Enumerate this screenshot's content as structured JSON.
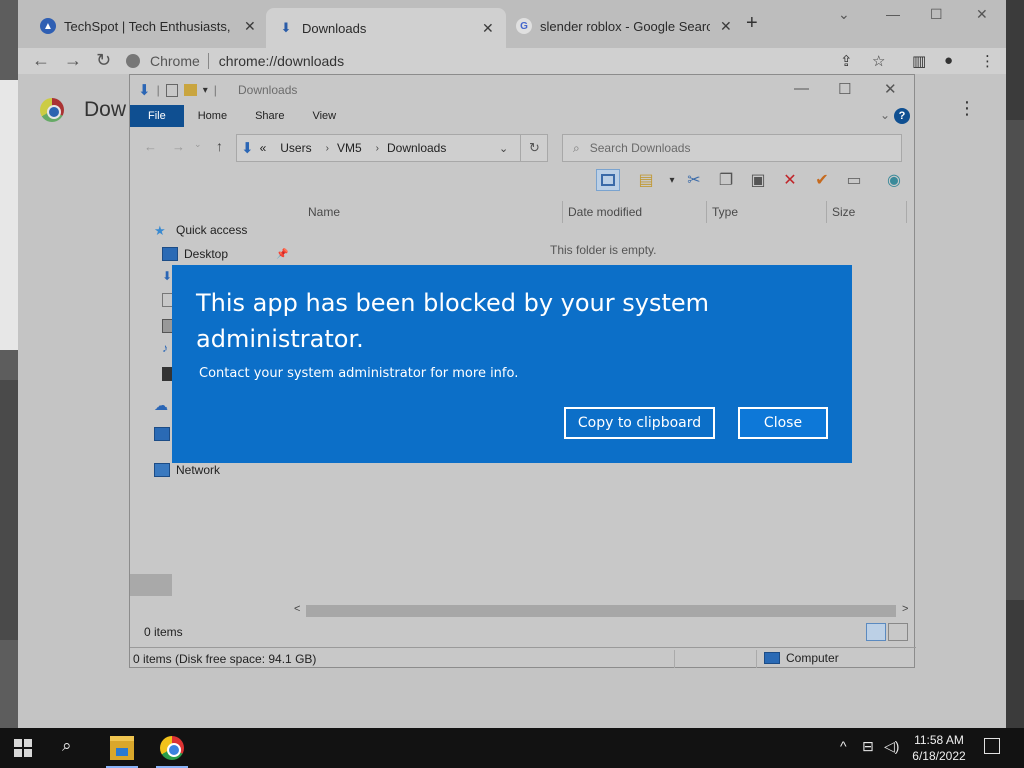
{
  "browser": {
    "tabs": [
      {
        "title": "TechSpot | Tech Enthusiasts, Pow",
        "active": false
      },
      {
        "title": "Downloads",
        "active": true
      },
      {
        "title": "slender roblox - Google Search",
        "active": false
      }
    ],
    "new_tab_label": "+",
    "omnibox": {
      "site_label": "Chrome",
      "url": "chrome://downloads"
    },
    "page_title": "Dow"
  },
  "explorer": {
    "window_title": "Downloads",
    "ribbon_tabs": [
      "File",
      "Home",
      "Share",
      "View"
    ],
    "help_label": "?",
    "breadcrumb": [
      "Users",
      "VM5",
      "Downloads"
    ],
    "breadcrumb_prefix": "«",
    "search_placeholder": "Search Downloads",
    "columns": [
      "Name",
      "Date modified",
      "Type",
      "Size"
    ],
    "empty_message": "This folder is empty.",
    "nav": {
      "quick_access": "Quick access",
      "desktop": "Desktop",
      "network": "Network"
    },
    "item_count": "0 items",
    "status_text": "0 items (Disk free space: 94.1 GB)",
    "status_location": "Computer"
  },
  "dialog": {
    "title": "This app has been blocked by your system administrator.",
    "message": "Contact your system administrator for more info.",
    "copy_label": "Copy to clipboard",
    "close_label": "Close"
  },
  "taskbar": {
    "time": "11:58 AM",
    "date": "6/18/2022"
  },
  "colors": {
    "dialog_blue": "#0c6fc8",
    "file_tab": "#0f4f91",
    "taskbar": "#121212"
  }
}
